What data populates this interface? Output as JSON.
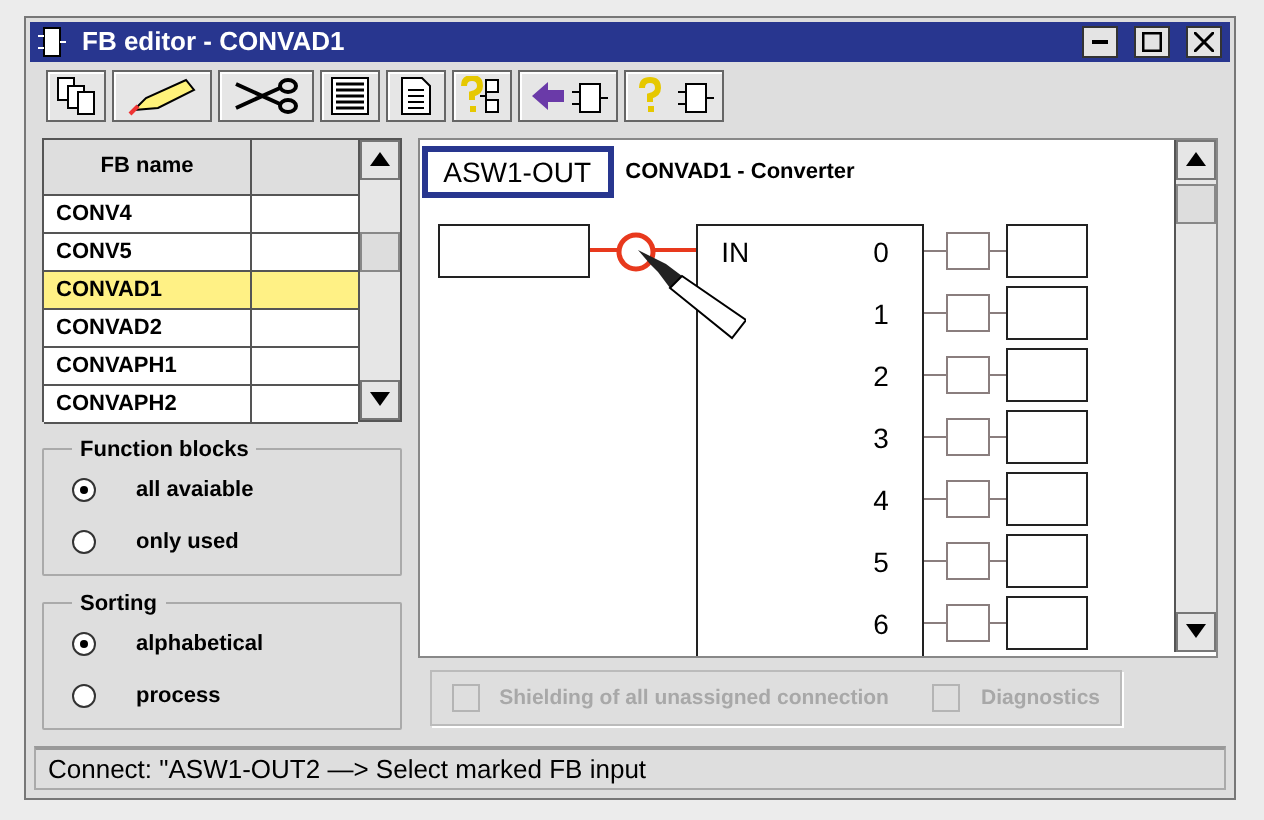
{
  "window": {
    "title": "FB editor - CONVAD1"
  },
  "fb_table": {
    "columns": [
      "FB name"
    ],
    "rows": [
      {
        "name": "CONV4",
        "selected": false
      },
      {
        "name": "CONV5",
        "selected": false
      },
      {
        "name": "CONVAD1",
        "selected": true
      },
      {
        "name": "CONVAD2",
        "selected": false
      },
      {
        "name": "CONVAPH1",
        "selected": false
      },
      {
        "name": "CONVAPH2",
        "selected": false
      }
    ]
  },
  "function_blocks": {
    "title": "Function blocks",
    "options": [
      {
        "label": "all avaiable",
        "selected": true
      },
      {
        "label": "only used",
        "selected": false
      }
    ]
  },
  "sorting": {
    "title": "Sorting",
    "options": [
      {
        "label": "alphabetical",
        "selected": true
      },
      {
        "label": "process",
        "selected": false
      }
    ]
  },
  "diagram": {
    "source": "ASW1-OUT",
    "block_title": "CONVAD1 - Converter",
    "input": "IN",
    "outputs": [
      "0",
      "1",
      "2",
      "3",
      "4",
      "5",
      "6"
    ]
  },
  "options": [
    {
      "label": "Shielding of all unassigned connection",
      "checked": false,
      "disabled": true
    },
    {
      "label": "Diagnostics",
      "checked": false,
      "disabled": true
    }
  ],
  "status_bar": "Connect: \"ASW1-OUT2 —> Select marked FB input"
}
